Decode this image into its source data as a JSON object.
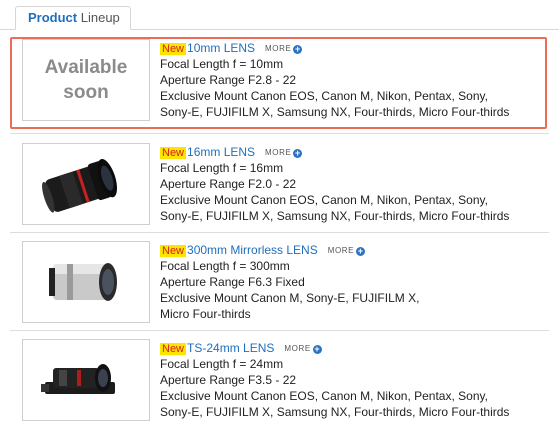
{
  "tab": {
    "label_a": "Product",
    "label_b": "Lineup"
  },
  "items": [
    {
      "badge": "New",
      "name": "10mm LENS",
      "more": "MORE",
      "image": {
        "type": "placeholder",
        "line1": "Available",
        "line2": "soon"
      },
      "lines": [
        "Focal Length f = 10mm",
        "Aperture Range F2.8 - 22",
        "Exclusive Mount Canon EOS, Canon M, Nikon, Pentax, Sony,",
        "Sony-E, FUJIFILM X, Samsung NX, Four-thirds, Micro Four-thirds"
      ]
    },
    {
      "badge": "New",
      "name": "16mm LENS",
      "more": "MORE",
      "image": {
        "type": "lens-black-red"
      },
      "lines": [
        "Focal Length f = 16mm",
        "Aperture Range F2.0 - 22",
        "Exclusive Mount Canon EOS, Canon M, Nikon, Pentax, Sony,",
        "Sony-E, FUJIFILM X, Samsung NX, Four-thirds, Micro Four-thirds"
      ]
    },
    {
      "badge": "New",
      "name": "300mm Mirrorless LENS",
      "more": "MORE",
      "image": {
        "type": "lens-silver"
      },
      "lines": [
        "Focal Length f = 300mm",
        "Aperture Range F6.3 Fixed",
        "Exclusive Mount Canon M, Sony-E, FUJIFILM X,",
        "Micro Four-thirds"
      ]
    },
    {
      "badge": "New",
      "name": "TS-24mm LENS",
      "more": "MORE",
      "image": {
        "type": "lens-tilt-shift"
      },
      "lines": [
        "Focal Length f = 24mm",
        "Aperture Range F3.5 - 22",
        "Exclusive Mount Canon EOS, Canon M, Nikon, Pentax, Sony,",
        "Sony-E, FUJIFILM X, Samsung NX, Four-thirds, Micro Four-thirds"
      ]
    }
  ],
  "colors": {
    "accent": "#1f6fbd",
    "badge_bg": "#ffe400",
    "badge_text": "#d4211c",
    "highlight": "#ec6d57"
  }
}
